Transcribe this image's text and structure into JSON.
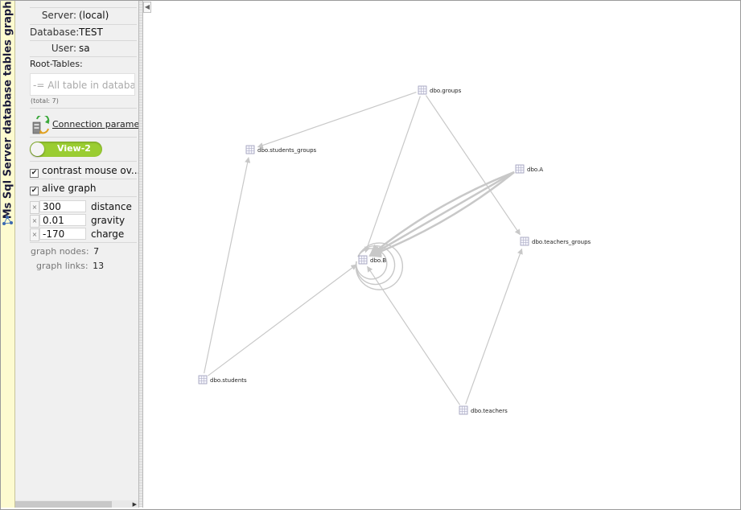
{
  "app": {
    "title": "Ms Sql Server database tables graph"
  },
  "panel": {
    "server_label": "Server:",
    "server_value": "(local)",
    "database_label": "Database:",
    "database_value": "TEST",
    "user_label": "User:",
    "user_value": "sa",
    "root_tables_label": "Root-Tables:",
    "root_tables_placeholder": "-= All table in database =-",
    "total_text": "(total: 7)",
    "connection_link": "Connection parameters",
    "view_toggle_label": "View-2",
    "contrast_label": "contrast mouse ov...",
    "contrast_checked": true,
    "alive_label": "alive graph",
    "alive_checked": true,
    "params": [
      {
        "value": "300",
        "name": "distance"
      },
      {
        "value": "0.01",
        "name": "gravity"
      },
      {
        "value": "-170",
        "name": "charge"
      }
    ],
    "graph_nodes_label": "graph nodes:",
    "graph_nodes_value": "7",
    "graph_links_label": "graph links:",
    "graph_links_value": "13"
  },
  "graph": {
    "nodes": [
      {
        "id": "groups",
        "label": "dbo.groups"
      },
      {
        "id": "students_groups",
        "label": "dbo.students_groups"
      },
      {
        "id": "A",
        "label": "dbo.A"
      },
      {
        "id": "teachers_groups",
        "label": "dbo.teachers_groups"
      },
      {
        "id": "B",
        "label": "dbo.B"
      },
      {
        "id": "students",
        "label": "dbo.students"
      },
      {
        "id": "teachers",
        "label": "dbo.teachers"
      }
    ],
    "links": [
      {
        "source": "groups",
        "target": "students_groups"
      },
      {
        "source": "groups",
        "target": "teachers_groups"
      },
      {
        "source": "groups",
        "target": "B"
      },
      {
        "source": "A",
        "target": "B"
      },
      {
        "source": "A",
        "target": "B"
      },
      {
        "source": "A",
        "target": "B"
      },
      {
        "source": "B",
        "target": "B"
      },
      {
        "source": "B",
        "target": "B"
      },
      {
        "source": "B",
        "target": "B"
      },
      {
        "source": "students",
        "target": "students_groups"
      },
      {
        "source": "students",
        "target": "B"
      },
      {
        "source": "teachers",
        "target": "teachers_groups"
      },
      {
        "source": "teachers",
        "target": "B"
      }
    ],
    "colors": {
      "edge": "#c8c8c8",
      "text": "#222222"
    }
  }
}
